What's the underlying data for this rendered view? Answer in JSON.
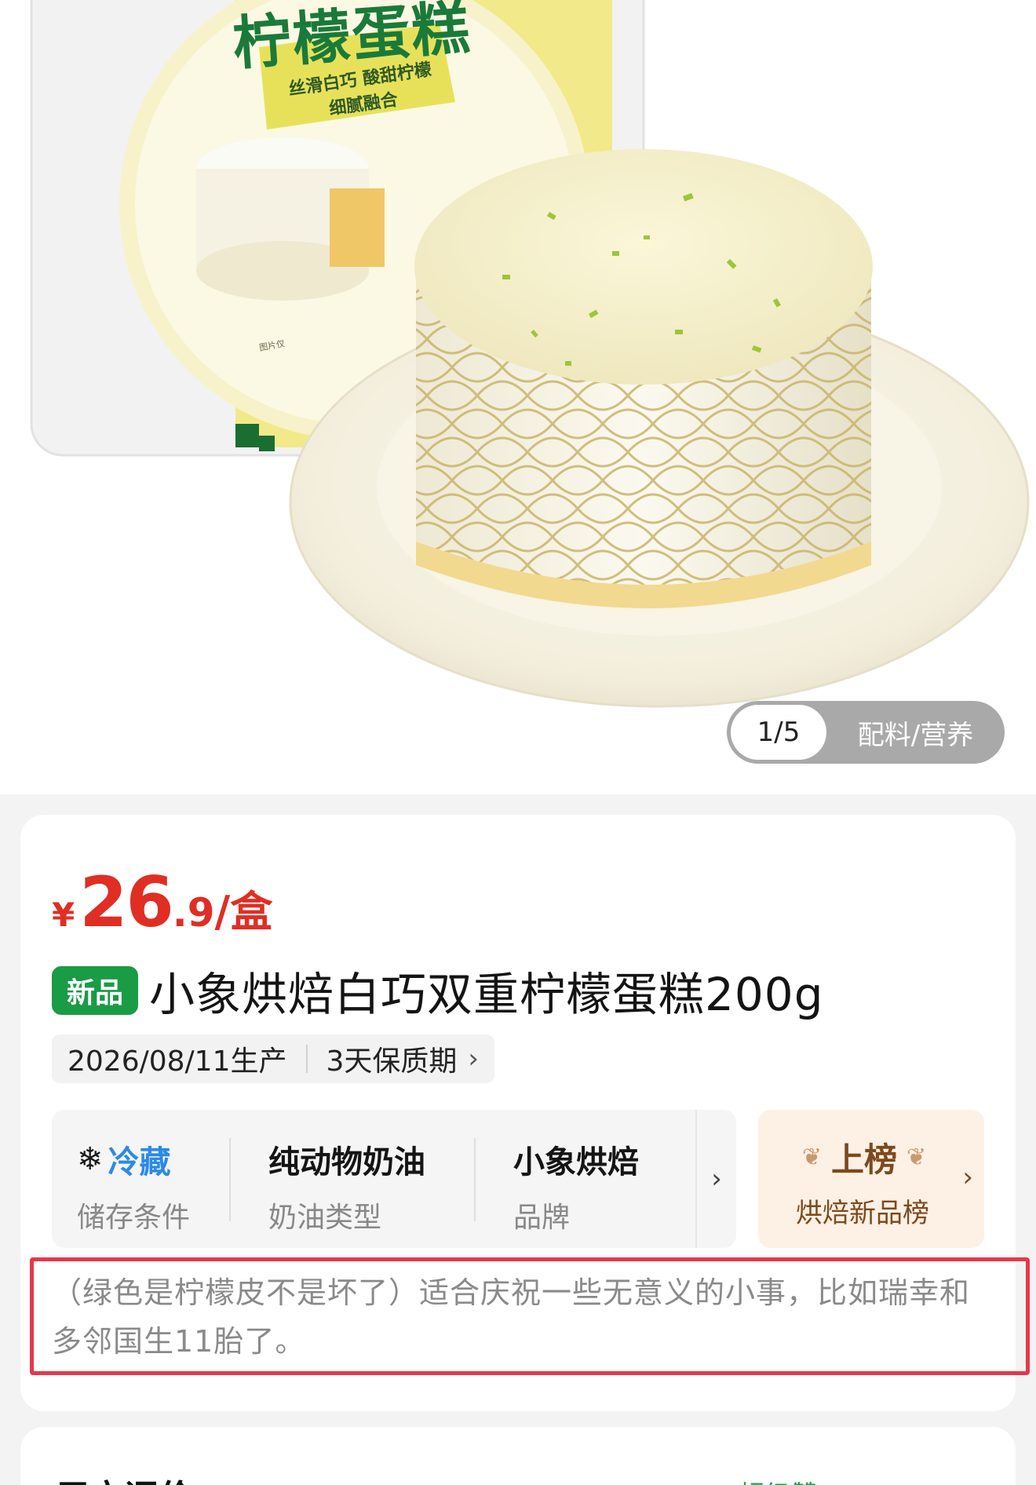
{
  "gallery": {
    "package_title": "柠檬蛋糕",
    "package_subtitle_line1": "丝滑白巧 酸甜柠檬",
    "package_subtitle_line2": "细腻融合",
    "package_small_text": "图片仅",
    "page_indicator": "1/5",
    "tab_label": "配料/营养"
  },
  "product": {
    "price_currency": "¥",
    "price_integer": "26",
    "price_decimal": ".9",
    "price_unit": "/盒",
    "badge": "新品",
    "name": "小象烘焙白巧双重柠檬蛋糕200g",
    "production_date": "2026/08/11生产",
    "shelf_life": "3天保质期",
    "attributes": [
      {
        "value": "冷藏",
        "label": "储存条件",
        "icon": "snowflake-icon"
      },
      {
        "value": "纯动物奶油",
        "label": "奶油类型"
      },
      {
        "value": "小象烘焙",
        "label": "品牌"
      }
    ],
    "ranking": {
      "title": "上榜",
      "subtitle": "烘焙新品榜"
    },
    "annotation_note": "（绿色是柠檬皮不是坏了）适合庆祝一些无意义的小事，比如瑞幸和多邻国生11胎了。"
  },
  "next_section": {
    "title": "用户评价",
    "right_text": "超级赞"
  },
  "colors": {
    "price": "#e02e24",
    "badge_green": "#1a9b45",
    "storage_blue": "#2b8ae6",
    "rank_bg": "#fdf0e4",
    "highlight_red": "#e8364a"
  }
}
